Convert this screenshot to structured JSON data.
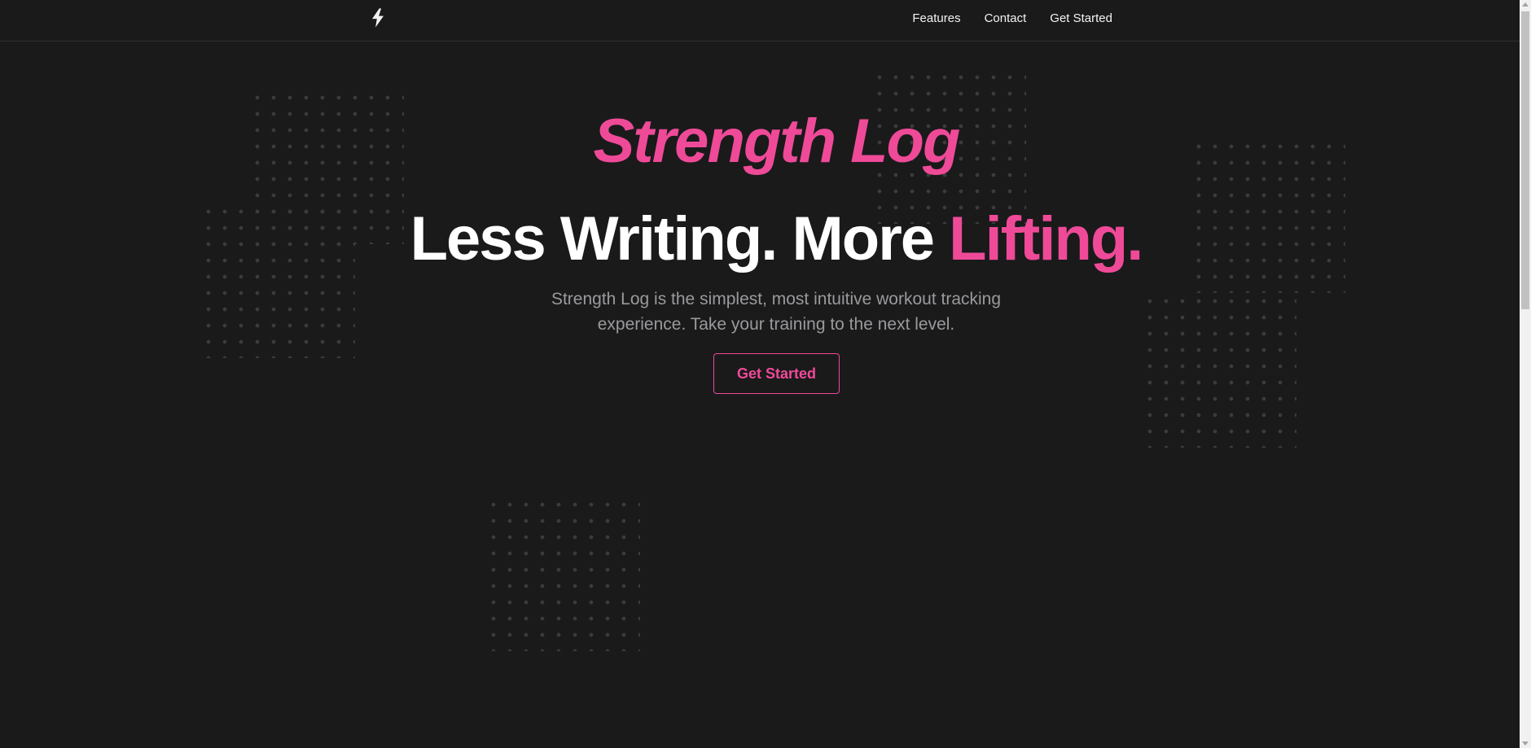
{
  "nav": {
    "logo_icon": "lightning-bolt-icon",
    "links": [
      {
        "label": "Features"
      },
      {
        "label": "Contact"
      },
      {
        "label": "Get Started"
      }
    ]
  },
  "hero": {
    "brand": "Strength Log",
    "headline_main": "Less Writing. More ",
    "headline_accent": "Lifting.",
    "subtitle": "Strength Log is the simplest, most intuitive workout tracking experience. Take your training to the next level.",
    "cta_label": "Get Started"
  },
  "colors": {
    "background": "#1a1a1b",
    "accent": "#ef4a98",
    "text": "#ffffff",
    "muted": "#9a9a9d"
  }
}
